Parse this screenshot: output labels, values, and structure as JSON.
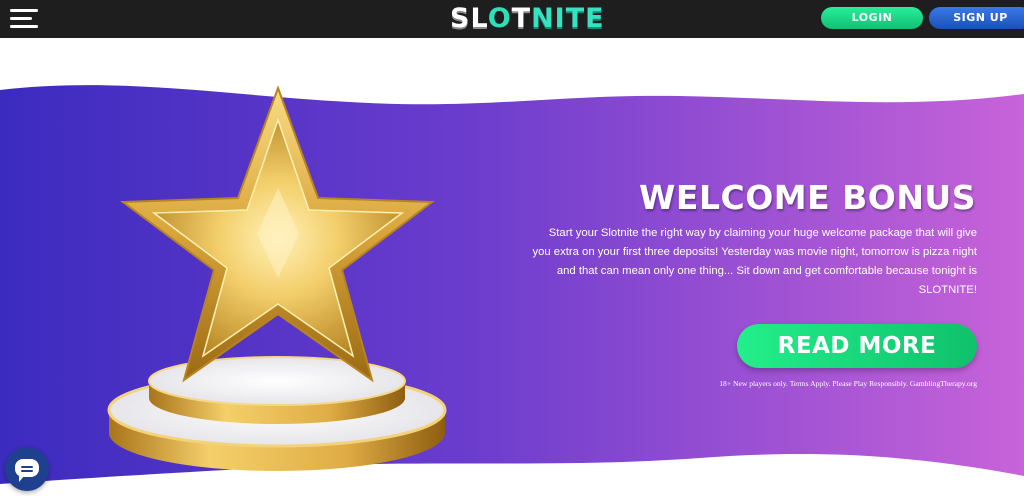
{
  "header": {
    "logo_left": "SL",
    "logo_o": "O",
    "logo_t": "T",
    "logo_right": "NITE",
    "login_label": "LOGIN",
    "signup_label": "SIGN UP"
  },
  "hero": {
    "title": "WELCOME BONUS",
    "description": "Start your Slotnite the right way by claiming your huge welcome package that will give you extra on your first three deposits! Yesterday was movie night, tomorrow is pizza night and that can mean only one thing... Sit down and get comfortable because tonight is SLOTNITE!",
    "cta_label": "READ MORE",
    "disclaimer": "18+ New players only. Terms Apply. Please Play Responsibly. GamblingTherapy.org"
  },
  "colors": {
    "topbar": "#1e1e1e",
    "gradient_start": "#3f2fc2",
    "gradient_end": "#c461d8",
    "login_green": "#19d97f",
    "signup_blue": "#2c64d4",
    "cta_green": "#19d97f",
    "logo_accent": "#2ee0b8"
  },
  "icons": {
    "menu": "hamburger-menu-icon",
    "chat": "chat-bubble-icon",
    "trophy": "gold-star-trophy"
  }
}
